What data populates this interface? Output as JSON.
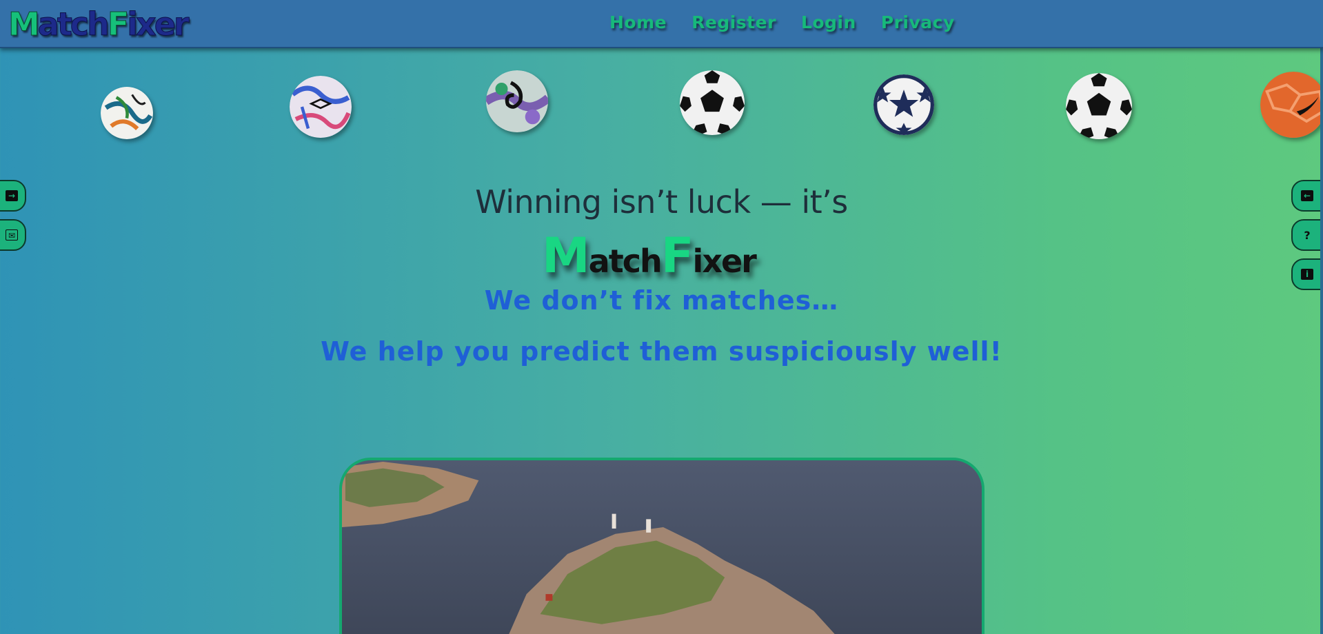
{
  "header": {
    "logo": {
      "m": "M",
      "atch": "atch",
      "f": "F",
      "ixer": "ixer"
    },
    "nav": [
      "Home",
      "Register",
      "Login",
      "Privacy"
    ]
  },
  "balls": [
    {
      "icon": "brazuca-ball-icon"
    },
    {
      "icon": "umbro-ball-icon"
    },
    {
      "icon": "purple-ball-icon"
    },
    {
      "icon": "classic-ball-icon"
    },
    {
      "icon": "star-ball-icon"
    },
    {
      "icon": "classic-ball-icon"
    },
    {
      "icon": "orange-ball-icon"
    }
  ],
  "side_left": [
    {
      "icon": "arrow-right-icon",
      "glyph": "→"
    },
    {
      "icon": "envelope-icon",
      "glyph": "✉"
    }
  ],
  "side_right": [
    {
      "icon": "arrow-left-icon",
      "glyph": "←"
    },
    {
      "icon": "question-icon",
      "glyph": "?"
    },
    {
      "icon": "info-icon",
      "glyph": "i"
    }
  ],
  "hero": {
    "tagline": "Winning isn’t luck — it’s",
    "logo": {
      "m": "M",
      "atch": "atch",
      "f": "F",
      "ixer": "ixer"
    },
    "line1": "We don’t fix matches…",
    "line2": "We help you predict them suspiciously well!"
  },
  "colors": {
    "accent_green": "#19d683",
    "header_blue": "#3471a9",
    "subtitle_blue": "#1f5fd6"
  }
}
